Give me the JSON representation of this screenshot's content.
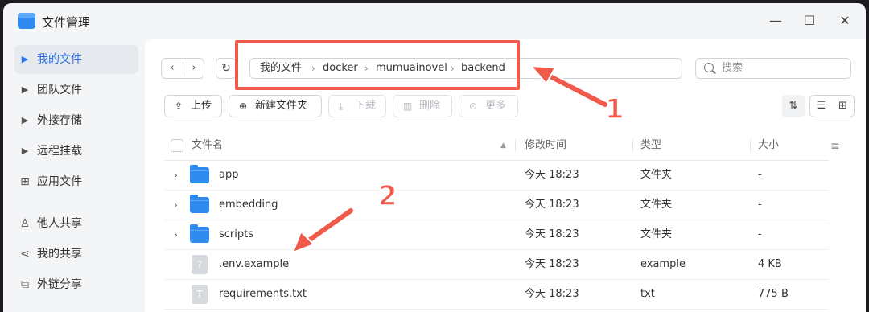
{
  "window": {
    "title": "文件管理",
    "controls": [
      "minimize",
      "maximize",
      "close"
    ]
  },
  "sidebar": {
    "items": [
      {
        "label": "我的文件",
        "icon": "caret-right-icon",
        "active": true
      },
      {
        "label": "团队文件",
        "icon": "caret-right-icon"
      },
      {
        "label": "外接存储",
        "icon": "caret-right-icon"
      },
      {
        "label": "远程挂载",
        "icon": "caret-right-icon"
      },
      {
        "label": "应用文件",
        "icon": "apps-grid-icon"
      },
      {
        "label": "他人共享",
        "icon": "user-icon"
      },
      {
        "label": "我的共享",
        "icon": "share-icon"
      },
      {
        "label": "外链分享",
        "icon": "external-link-icon"
      }
    ]
  },
  "breadcrumb": [
    "我的文件",
    "docker",
    "mumuainovel",
    "backend"
  ],
  "search": {
    "placeholder": "搜索"
  },
  "toolbar": {
    "upload": "上传",
    "new_folder": "新建文件夹",
    "download": "下载",
    "delete": "删除",
    "more": "更多"
  },
  "table": {
    "headers": {
      "name": "文件名",
      "modified": "修改时间",
      "type": "类型",
      "size": "大小"
    },
    "rows": [
      {
        "name": "app",
        "modified": "今天 18:23",
        "type": "文件夹",
        "size": "-",
        "kind": "folder"
      },
      {
        "name": "embedding",
        "modified": "今天 18:23",
        "type": "文件夹",
        "size": "-",
        "kind": "folder"
      },
      {
        "name": "scripts",
        "modified": "今天 18:23",
        "type": "文件夹",
        "size": "-",
        "kind": "folder"
      },
      {
        "name": ".env.example",
        "modified": "今天 18:23",
        "type": "example",
        "size": "4 KB",
        "kind": "unknown-file"
      },
      {
        "name": "requirements.txt",
        "modified": "今天 18:23",
        "type": "txt",
        "size": "775 B",
        "kind": "text-file"
      }
    ]
  },
  "annotations": {
    "label_1": "1",
    "label_2": "2",
    "color": "#f05a4a"
  },
  "colors": {
    "accent": "#2a6ee8",
    "folder": "#2f8bf0"
  }
}
